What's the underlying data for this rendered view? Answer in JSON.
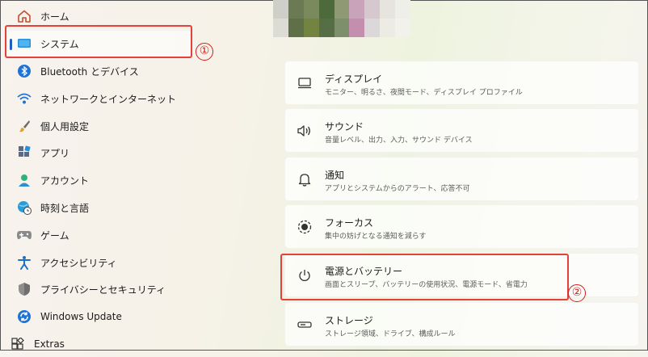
{
  "sidebar": {
    "items": [
      {
        "label": "ホーム",
        "icon": "home-icon"
      },
      {
        "label": "システム",
        "icon": "system-display-icon",
        "selected": true
      },
      {
        "label": "Bluetooth とデバイス",
        "icon": "bluetooth-icon"
      },
      {
        "label": "ネットワークとインターネット",
        "icon": "wifi-icon"
      },
      {
        "label": "個人用設定",
        "icon": "brush-icon"
      },
      {
        "label": "アプリ",
        "icon": "apps-icon"
      },
      {
        "label": "アカウント",
        "icon": "account-icon"
      },
      {
        "label": "時刻と言語",
        "icon": "globe-clock-icon"
      },
      {
        "label": "ゲーム",
        "icon": "gamepad-icon"
      },
      {
        "label": "アクセシビリティ",
        "icon": "accessibility-icon"
      },
      {
        "label": "プライバシーとセキュリティ",
        "icon": "shield-icon"
      },
      {
        "label": "Windows Update",
        "icon": "update-icon"
      },
      {
        "label": "Extras",
        "icon": "extras-icon"
      }
    ]
  },
  "cards": [
    {
      "title": "ディスプレイ",
      "desc": "モニター、明るさ、夜間モード、ディスプレイ プロファイル",
      "icon": "display-icon"
    },
    {
      "title": "サウンド",
      "desc": "音量レベル、出力、入力、サウンド デバイス",
      "icon": "speaker-icon"
    },
    {
      "title": "通知",
      "desc": "アプリとシステムからのアラート、応答不可",
      "icon": "bell-icon"
    },
    {
      "title": "フォーカス",
      "desc": "集中の妨げとなる通知を減らす",
      "icon": "focus-icon"
    },
    {
      "title": "電源とバッテリー",
      "desc": "画面とスリープ、バッテリーの使用状況、電源モード、省電力",
      "icon": "power-icon"
    },
    {
      "title": "ストレージ",
      "desc": "ストレージ領域、ドライブ、構成ルール",
      "icon": "storage-icon"
    }
  ],
  "annotations": {
    "step1": "①",
    "step2": "②",
    "color": "#e5413c"
  },
  "colors": {
    "accent": "#1f5fbf",
    "mosaic": [
      "#cfcfc9",
      "#6b7a52",
      "#7a8a5c",
      "#4d6b3a",
      "#8f9a74",
      "#c9a3b9",
      "#d6c8cf",
      "#e6e4dc",
      "#efefe9",
      "#dcdcd4",
      "#5f7048",
      "#72843f",
      "#566e45",
      "#7e8f6b",
      "#c48fae",
      "#dcd7d8",
      "#ecebe4",
      "#f2f1ec"
    ]
  }
}
